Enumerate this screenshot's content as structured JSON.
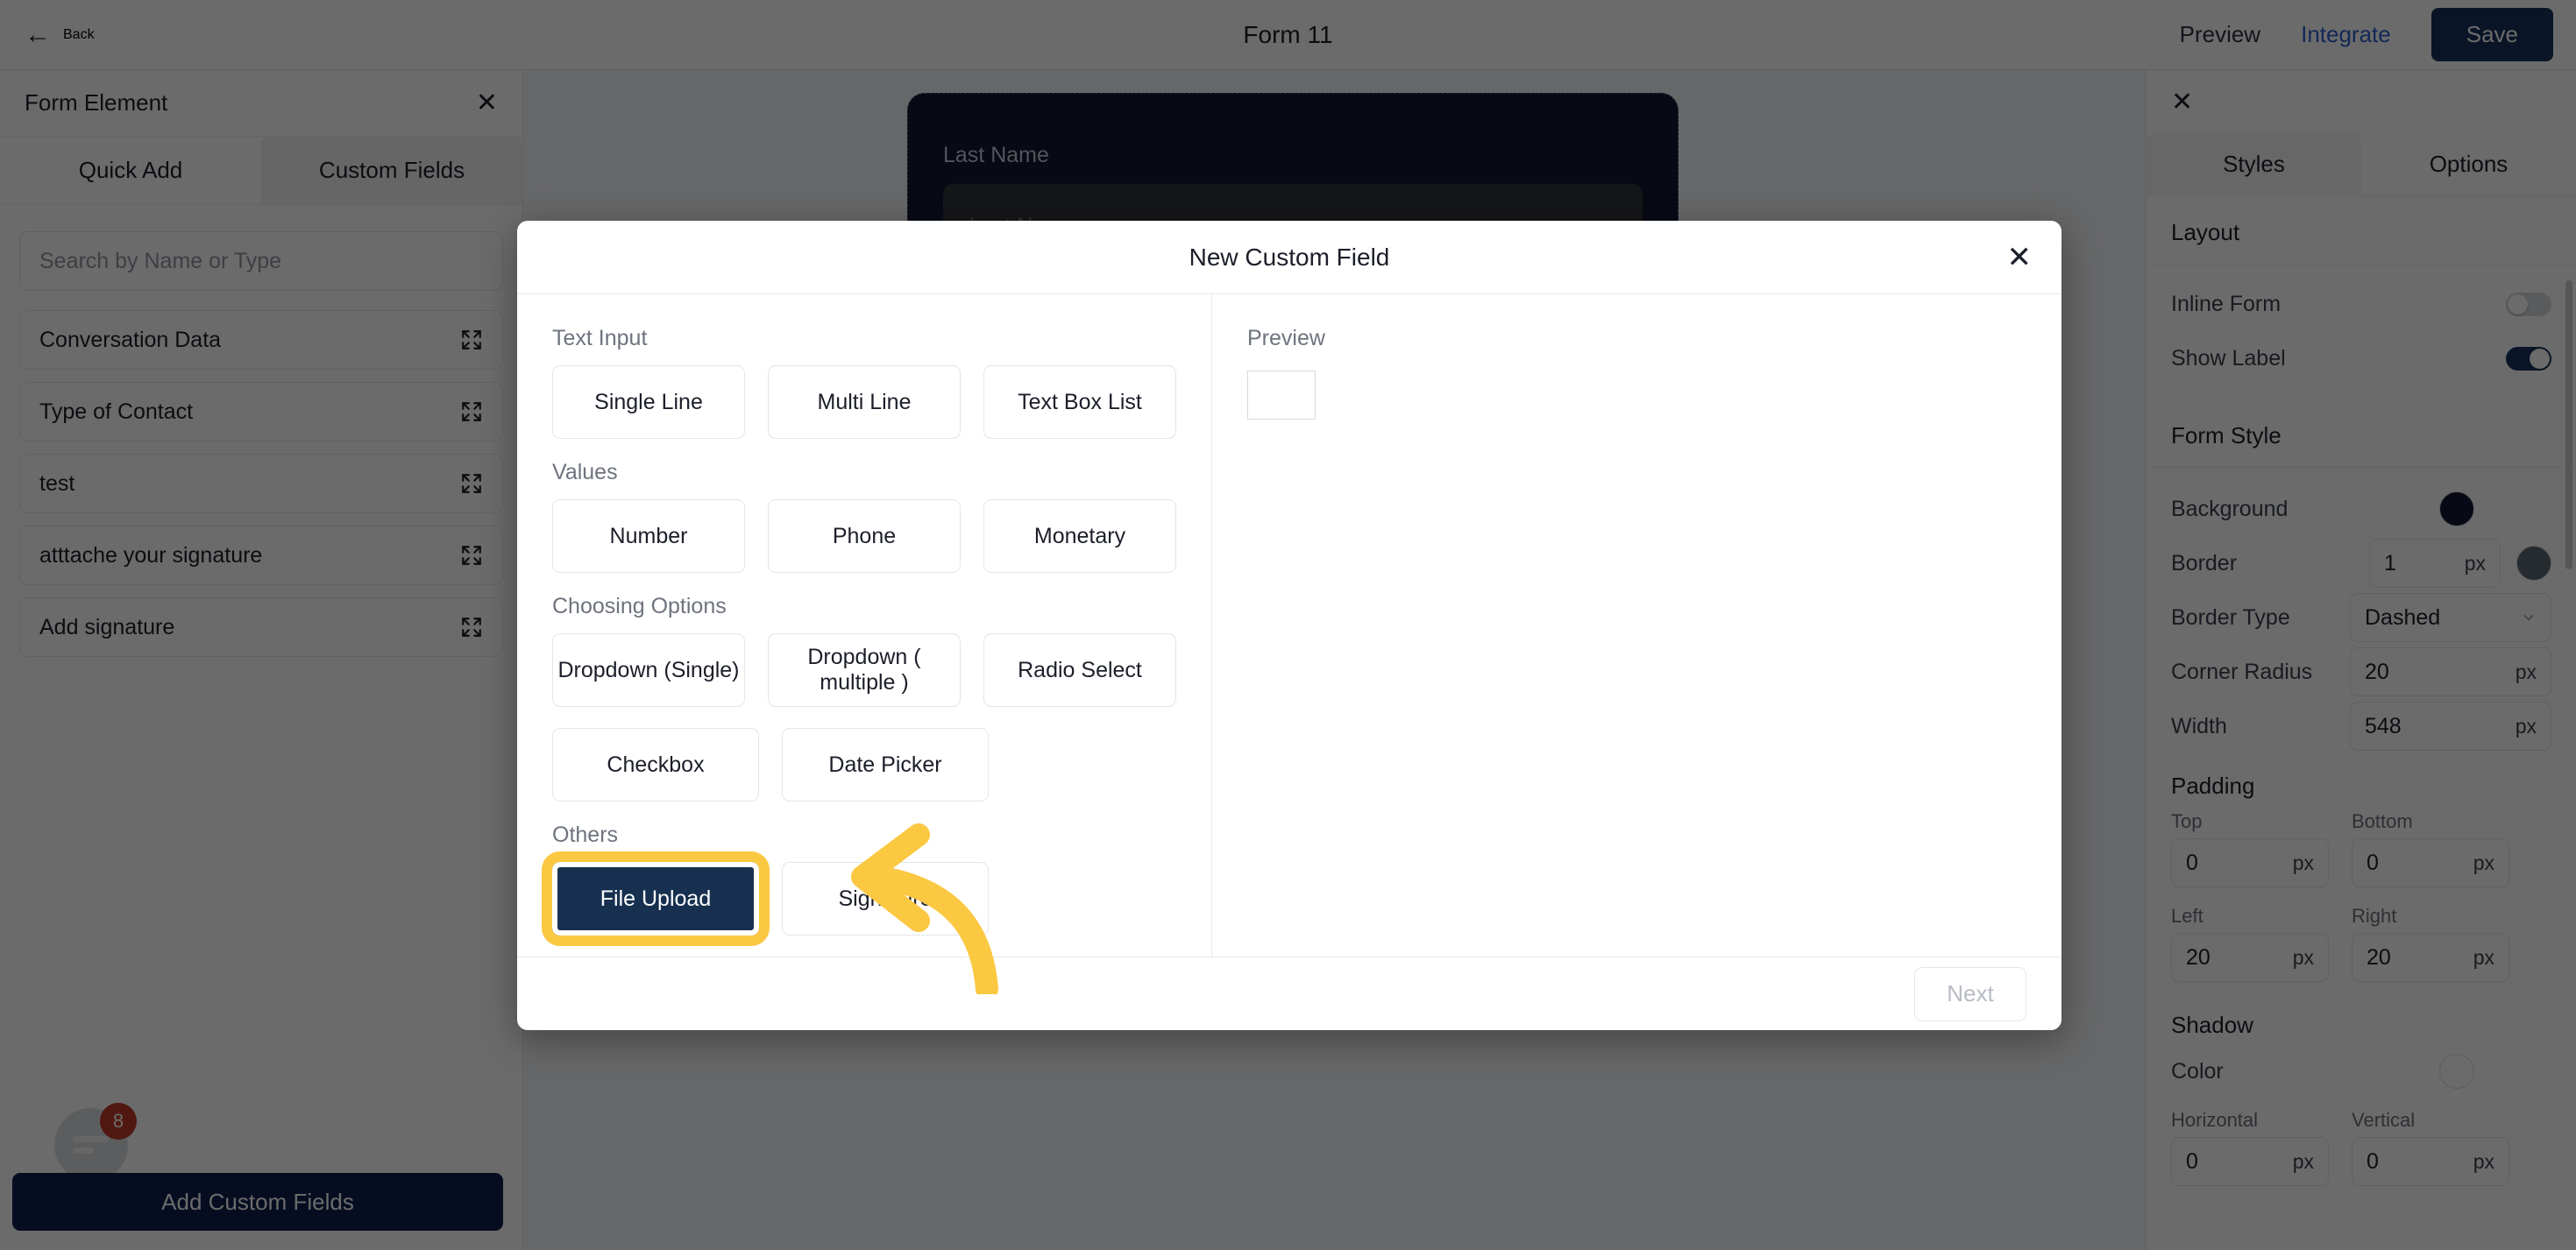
{
  "topbar": {
    "back_label": "Back",
    "back_icon": "arrow-left-icon",
    "title": "Form 11",
    "preview_label": "Preview",
    "integrate_label": "Integrate",
    "save_label": "Save",
    "accent_color": "#2f5fd0",
    "save_bg": "#17325d"
  },
  "left_panel": {
    "title": "Form Element",
    "close_icon": "close-icon",
    "tabs": [
      {
        "label": "Quick Add",
        "active": false
      },
      {
        "label": "Custom Fields",
        "active": true
      }
    ],
    "search_placeholder": "Search by Name or Type",
    "items": [
      {
        "label": "Conversation Data",
        "icon": "expand-icon"
      },
      {
        "label": "Type of Contact",
        "icon": "expand-icon"
      },
      {
        "label": "test",
        "icon": "expand-icon"
      },
      {
        "label": "atttache your signature",
        "icon": "expand-icon"
      },
      {
        "label": "Add signature",
        "icon": "expand-icon"
      }
    ],
    "chat_icon": "chat-bubble-icon",
    "chat_badge": "8",
    "add_custom_fields_label": "Add Custom Fields",
    "add_btn_bg": "#102150"
  },
  "canvas": {
    "field_label": "Last Name",
    "field_placeholder": "Last Name",
    "card_bg": "#121a33",
    "card_border": "#55607a"
  },
  "right_panel": {
    "close_icon": "close-icon",
    "tabs": [
      {
        "label": "Styles",
        "active": true
      },
      {
        "label": "Options",
        "active": false
      }
    ],
    "layout": {
      "section_title": "Layout",
      "rows": [
        {
          "label": "Inline Form",
          "control": "toggle",
          "value": "off"
        },
        {
          "label": "Show Label",
          "control": "toggle",
          "value": "on"
        }
      ]
    },
    "form_style": {
      "section_title": "Form Style",
      "background_label": "Background",
      "background_color": "#111833",
      "border_label": "Border",
      "border_value": "1",
      "border_unit": "px",
      "border_color": "#5b6672",
      "border_type_label": "Border Type",
      "border_type_value": "Dashed",
      "corner_radius_label": "Corner Radius",
      "corner_radius_value": "20",
      "corner_radius_unit": "px",
      "width_label": "Width",
      "width_value": "548",
      "width_unit": "px"
    },
    "padding": {
      "title": "Padding",
      "fields": [
        {
          "label": "Top",
          "value": "0",
          "unit": "px"
        },
        {
          "label": "Bottom",
          "value": "0",
          "unit": "px"
        },
        {
          "label": "Left",
          "value": "20",
          "unit": "px"
        },
        {
          "label": "Right",
          "value": "20",
          "unit": "px"
        }
      ]
    },
    "shadow": {
      "title": "Shadow",
      "color_label": "Color",
      "color_value": "#ffffff",
      "fields": [
        {
          "label": "Horizontal",
          "value": "0",
          "unit": "px"
        },
        {
          "label": "Vertical",
          "value": "0",
          "unit": "px"
        }
      ]
    }
  },
  "modal": {
    "title": "New Custom Field",
    "close_icon": "close-icon",
    "groups": [
      {
        "title": "Text Input",
        "buttons": [
          {
            "label": "Single Line",
            "selected": false
          },
          {
            "label": "Multi Line",
            "selected": false
          },
          {
            "label": "Text Box List",
            "selected": false
          }
        ]
      },
      {
        "title": "Values",
        "buttons": [
          {
            "label": "Number",
            "selected": false
          },
          {
            "label": "Phone",
            "selected": false
          },
          {
            "label": "Monetary",
            "selected": false
          }
        ]
      },
      {
        "title": "Choosing Options",
        "buttons": [
          {
            "label": "Dropdown (Single)",
            "selected": false
          },
          {
            "label": "Dropdown ( multiple )",
            "selected": false
          },
          {
            "label": "Radio Select",
            "selected": false
          }
        ]
      },
      {
        "title": "",
        "buttons": [
          {
            "label": "Checkbox",
            "selected": false
          },
          {
            "label": "Date Picker",
            "selected": false
          }
        ]
      },
      {
        "title": "Others",
        "buttons": [
          {
            "label": "File Upload",
            "selected": true
          },
          {
            "label": "Signature",
            "selected": false
          }
        ]
      }
    ],
    "preview_title": "Preview",
    "next_label": "Next",
    "highlight_color": "#fbc841",
    "selected_bg": "#17304f"
  }
}
